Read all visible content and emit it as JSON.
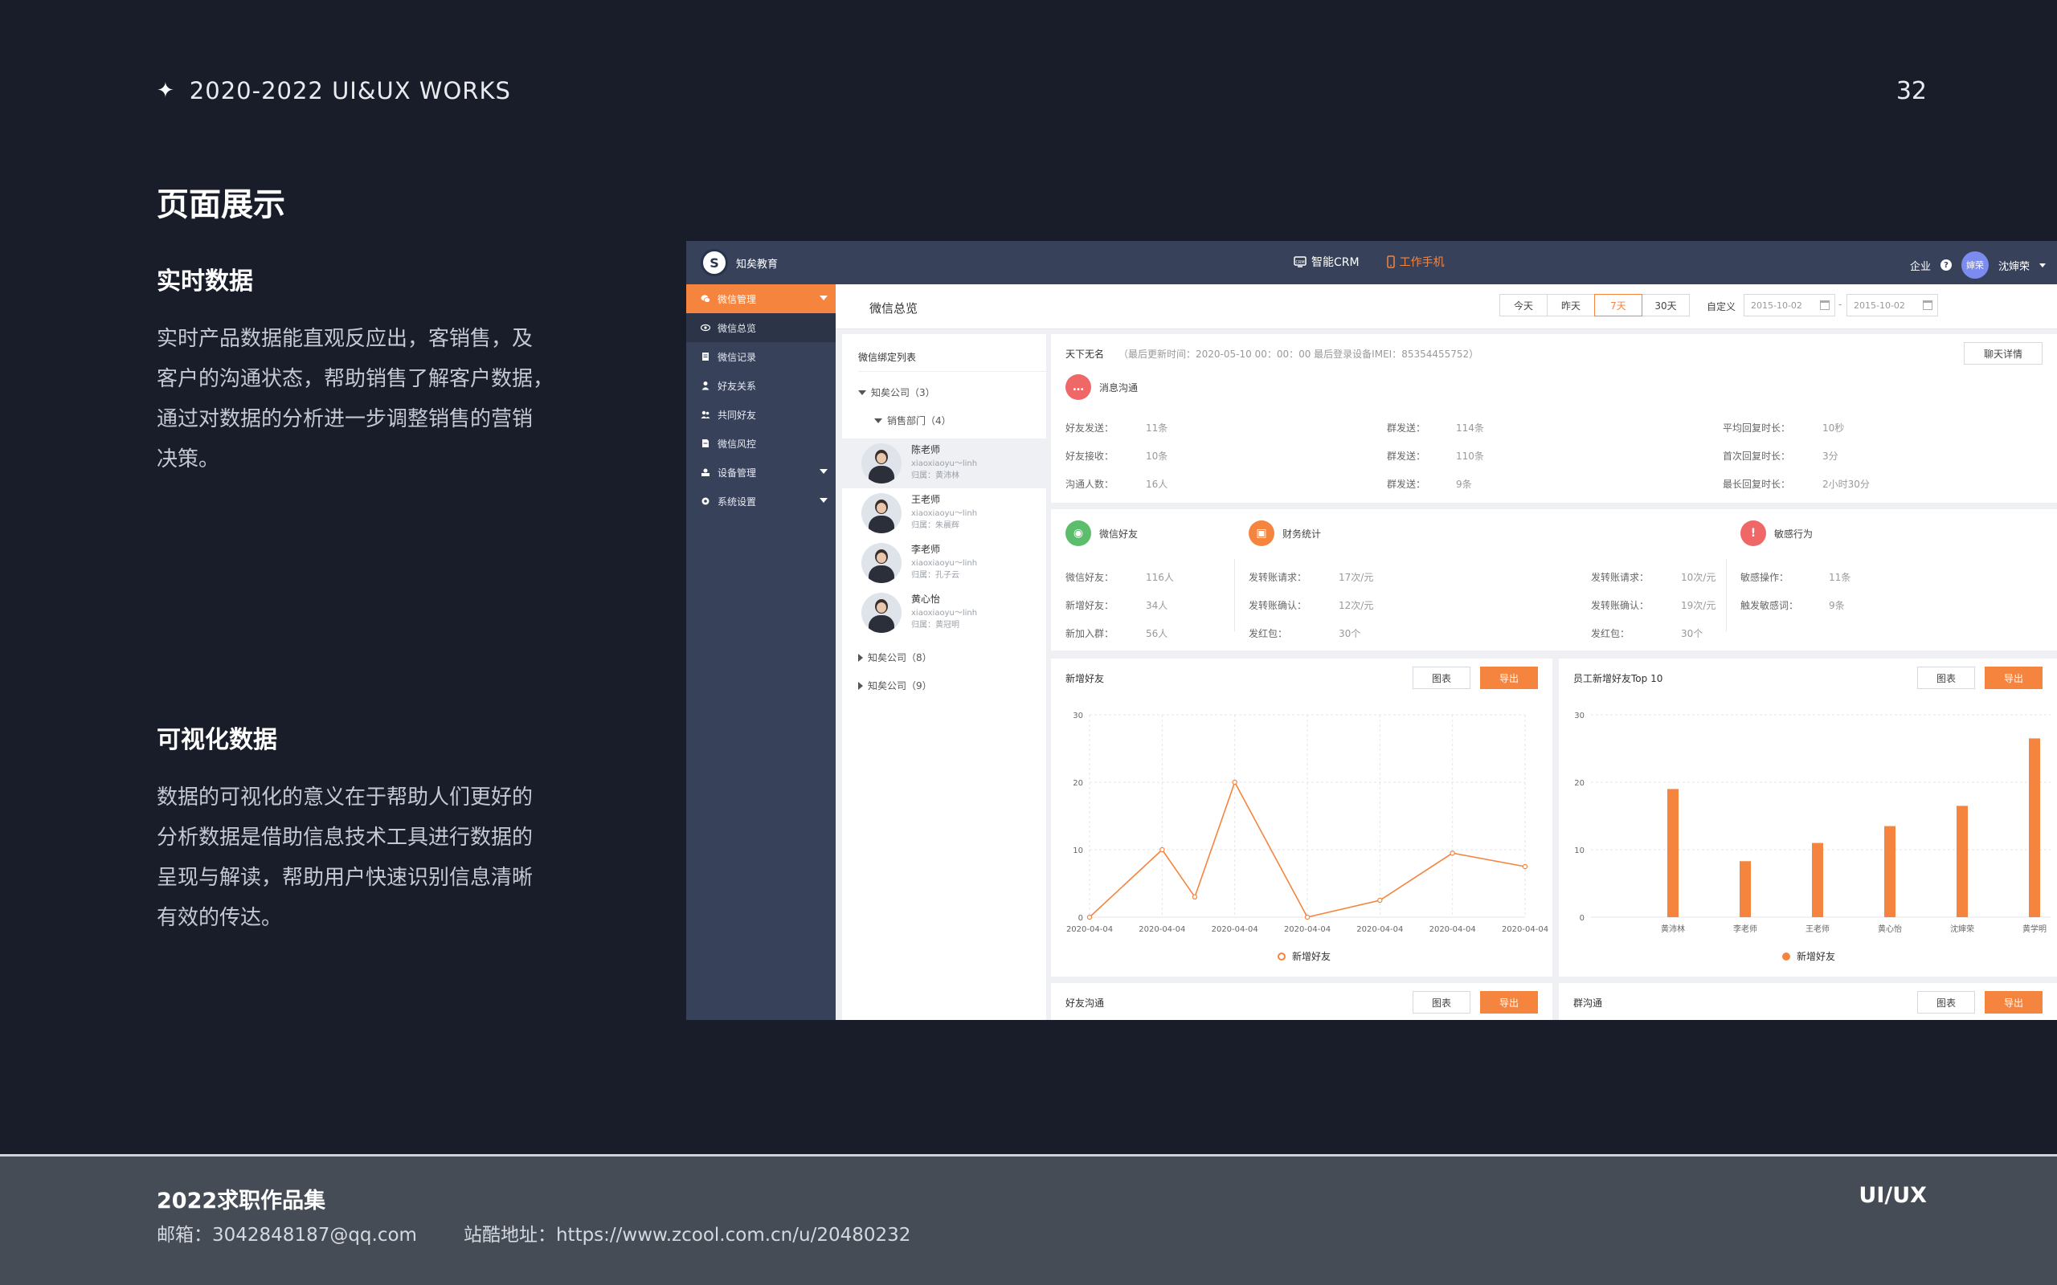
{
  "header": {
    "star": "✦",
    "title": "2020-2022  UI&UX  WORKS",
    "page_number": "32"
  },
  "section_title": "页面展示",
  "blocks": [
    {
      "heading": "实时数据",
      "lines": [
        "实时产品数据能直观反应出，客销售，及",
        "客户的沟通状态，帮助销售了解客户数据，",
        "通过对数据的分析进一步调整销售的营销",
        "决策。"
      ]
    },
    {
      "heading": "可视化数据",
      "lines": [
        "数据的可视化的意义在于帮助人们更好的",
        "分析数据是借助信息技术工具进行数据的",
        "呈现与解读，帮助用户快速识别信息清晰",
        "有效的传达。"
      ]
    }
  ],
  "footer": {
    "title": "2022求职作品集",
    "email": "邮箱：3042848187@qq.com",
    "site": "站酷地址：https://www.zcool.com.cn/u/20480232",
    "right": "UI/UX"
  },
  "app": {
    "brand": "知矣教育",
    "nav": [
      {
        "label": "智能CRM",
        "icon": "crm-icon"
      },
      {
        "label": "工作手机",
        "icon": "phone-icon"
      }
    ],
    "top_right": {
      "enterprise": "企业",
      "help": "?",
      "avatar_text": "婶荣",
      "user": "沈婶荣"
    },
    "sidebar": [
      {
        "label": "微信管理",
        "icon": "wechat-icon"
      },
      {
        "label": "微信总览",
        "icon": "eye-icon"
      },
      {
        "label": "微信记录",
        "icon": "record-icon"
      },
      {
        "label": "好友关系",
        "icon": "user-icon"
      },
      {
        "label": "共同好友",
        "icon": "users-icon"
      },
      {
        "label": "微信风控",
        "icon": "shield-icon"
      },
      {
        "label": "设备管理",
        "icon": "device-icon"
      },
      {
        "label": "系统设置",
        "icon": "gear-icon"
      }
    ],
    "page_title": "微信总览",
    "ranges": [
      "今天",
      "昨天",
      "7天",
      "30天"
    ],
    "active_range": "7天",
    "custom_label": "自定义",
    "date_from": "2015-10-02",
    "date_sep": "-",
    "date_to": "2015-10-02",
    "tree": {
      "title": "微信绑定列表",
      "company1": "知矣公司（3）",
      "dept": "销售部门（4）",
      "people": [
        {
          "name": "陈老师",
          "id": "xiaoxiaoyu～linh",
          "owner": "归属：黄沛林"
        },
        {
          "name": "王老师",
          "id": "xiaoxiaoyu～linh",
          "owner": "归属：朱晨辉"
        },
        {
          "name": "李老师",
          "id": "xiaoxiaoyu～linh",
          "owner": "归属：孔子云"
        },
        {
          "name": "黄心怡",
          "id": "xiaoxiaoyu～linh",
          "owner": "归属：黄冠明"
        }
      ],
      "company2": "知矣公司（8）",
      "company3": "知矣公司（9）"
    },
    "info": {
      "name": "天下无名",
      "meta": "（最后更新时间：2020-05-10 00：00：00  最后登录设备IMEI：85354455752）",
      "detail_button": "聊天详情",
      "msg_section": "消息沟通",
      "msg_rows": [
        [
          {
            "k": "好友发送：",
            "v": "11条"
          },
          {
            "k": "群发送：",
            "v": "114条"
          },
          {
            "k": "平均回复时长：",
            "v": "10秒"
          }
        ],
        [
          {
            "k": "好友接收：",
            "v": "10条"
          },
          {
            "k": "群发送：",
            "v": "110条"
          },
          {
            "k": "首次回复时长：",
            "v": "3分"
          }
        ],
        [
          {
            "k": "沟通人数：",
            "v": "16人"
          },
          {
            "k": "群发送：",
            "v": "9条"
          },
          {
            "k": "最长回复时长：",
            "v": "2小时30分"
          }
        ]
      ],
      "friends_section": "微信好友",
      "finance_section": "财务统计",
      "sensitive_section": "敏感行为",
      "friends_rows": [
        {
          "k": "微信好友：",
          "v": "116人"
        },
        {
          "k": "新增好友：",
          "v": "34人"
        },
        {
          "k": "新加入群：",
          "v": "56人"
        }
      ],
      "finance_rows_a": [
        {
          "k": "发转账请求：",
          "v": "17次/元"
        },
        {
          "k": "发转账确认：",
          "v": "12次/元"
        },
        {
          "k": "发红包：",
          "v": "30个"
        }
      ],
      "finance_rows_b": [
        {
          "k": "发转账请求：",
          "v": "10次/元"
        },
        {
          "k": "发转账确认：",
          "v": "19次/元"
        },
        {
          "k": "发红包：",
          "v": "30个"
        }
      ],
      "sensitive_rows": [
        {
          "k": "敏感操作：",
          "v": "11条"
        },
        {
          "k": "触发敏感词：",
          "v": "9条"
        }
      ]
    },
    "buttons": {
      "chart": "图表",
      "export": "导出"
    },
    "bottom_cards": [
      "好友沟通",
      "群沟通"
    ],
    "colors": {
      "accent": "#f5843f",
      "nav_bg": "#37425a"
    }
  },
  "chart_data": [
    {
      "type": "line",
      "title": "新增好友",
      "x": [
        "2020-04-04",
        "2020-04-04",
        "2020-04-04",
        "2020-04-04",
        "2020-04-04",
        "2020-04-04",
        "2020-04-04",
        "2020-04-04"
      ],
      "x_values": [
        0,
        1,
        1.45,
        2,
        3,
        4,
        5,
        6
      ],
      "series": [
        {
          "name": "新增好友",
          "values": [
            0,
            10,
            3,
            20,
            0,
            2.5,
            9.5,
            7.5
          ]
        }
      ],
      "ylim": [
        0,
        30
      ],
      "yticks": [
        "0",
        "10",
        "20",
        "30"
      ],
      "grid": true,
      "legend": "bottom-center"
    },
    {
      "type": "bar",
      "title": "员工新增好友Top 10",
      "categories": [
        "黄沛林",
        "李老师",
        "王老师",
        "黄心怡",
        "沈婶荣",
        "黄学明"
      ],
      "series": [
        {
          "name": "新增好友",
          "values": [
            19,
            8.3,
            11,
            13.5,
            16.5,
            26.5
          ]
        }
      ],
      "ylim": [
        0,
        30
      ],
      "yticks": [
        "0",
        "10",
        "20",
        "30"
      ],
      "grid": true,
      "legend": "bottom-center"
    }
  ]
}
